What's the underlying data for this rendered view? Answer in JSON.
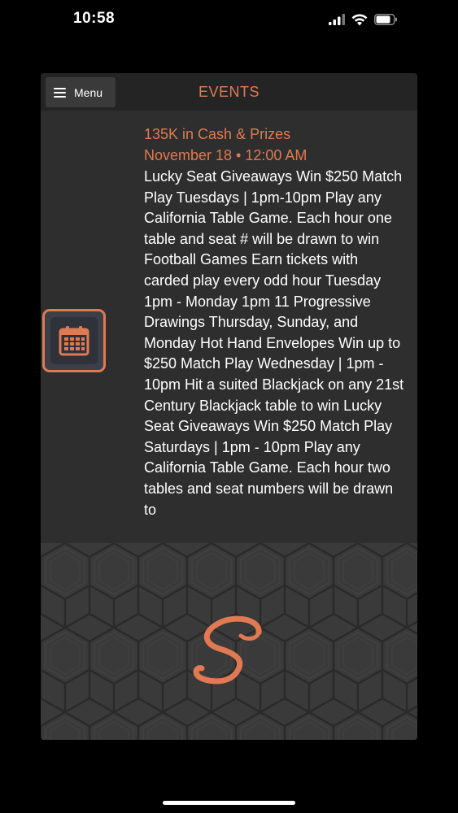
{
  "status_bar": {
    "time": "10:58"
  },
  "header": {
    "menu_label": "Menu",
    "title": "EVENTS"
  },
  "event": {
    "title": "135K in Cash & Prizes",
    "date": "November 18 • 12:00 AM",
    "description": "Lucky Seat Giveaways Win $250 Match Play Tuesdays | 1pm-10pm Play any California Table Game. Each hour one table and seat # will be drawn to win Football Games Earn tickets with carded play every odd hour Tuesday 1pm - Monday 1pm 11 Progressive Drawings Thursday, Sunday, and Monday Hot Hand Envelopes Win up to $250 Match Play Wednesday | 1pm - 10pm Hit a suited Blackjack on any 21st Century Blackjack table to win Lucky Seat Giveaways Win $250 Match Play Saturdays | 1pm - 10pm Play any California Table Game. Each hour two tables and seat numbers will be drawn to"
  },
  "icons": {
    "menu": "hamburger-icon",
    "calendar": "calendar-icon",
    "logo": "brand-logo",
    "signal": "signal-icon",
    "wifi": "wifi-icon",
    "battery": "battery-icon"
  },
  "colors": {
    "accent": "#e07a52",
    "background": "#2e2e2e",
    "header": "#242424"
  }
}
